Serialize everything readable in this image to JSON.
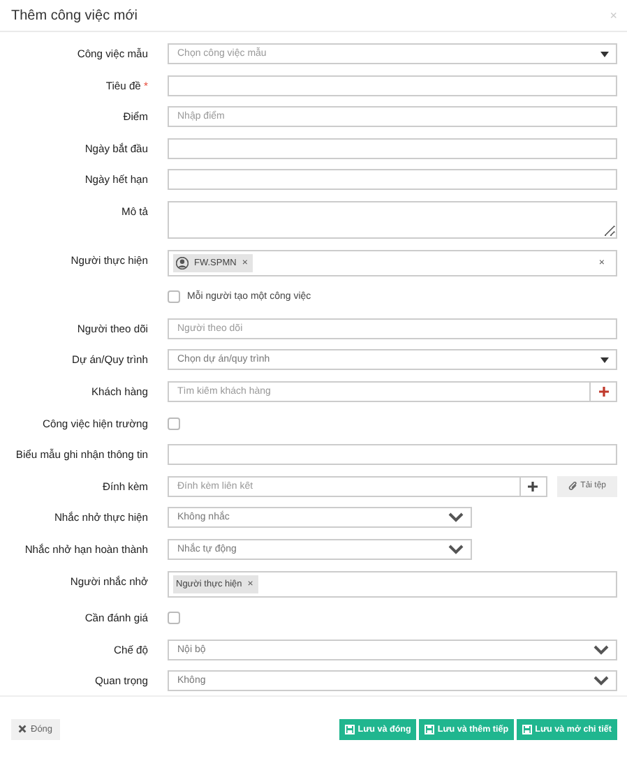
{
  "dialog": {
    "title": "Thêm công việc mới",
    "close": "×"
  },
  "fields": [
    {
      "kind": "caret-select",
      "label": "Công việc mẫu",
      "placeholder": "Chọn công việc mẫu"
    },
    {
      "kind": "text",
      "label": "Tiêu đề",
      "required_mark": "*"
    },
    {
      "kind": "text",
      "label": "Điểm",
      "placeholder": "Nhập điểm"
    },
    {
      "kind": "text",
      "label": "Ngày bắt đầu"
    },
    {
      "kind": "text",
      "label": "Ngày hết hạn"
    },
    {
      "kind": "textarea",
      "label": "Mô tả"
    },
    {
      "kind": "tags",
      "label": "Người thực hiện",
      "tags": [
        {
          "text": "FW.SPMN",
          "avatar": true,
          "remove": "×"
        }
      ],
      "clear": "×"
    },
    {
      "kind": "check-option",
      "text": "Mỗi người tạo một công việc",
      "checked": false
    },
    {
      "kind": "text",
      "label": "Người theo dõi",
      "placeholder": "Người theo dõi"
    },
    {
      "kind": "caret-select",
      "label": "Dự án/Quy trình",
      "value": "Chọn dự án/quy trình"
    },
    {
      "kind": "addon",
      "label": "Khách hàng",
      "placeholder": "Tìm kiếm khách hàng"
    },
    {
      "kind": "checkbox",
      "label": "Công việc hiện trường",
      "checked": false
    },
    {
      "kind": "text",
      "label": "Biểu mẫu ghi nhận thông tin"
    },
    {
      "kind": "attach",
      "label": "Đính kèm",
      "placeholder": "Đính kèm liên kết",
      "button": "Tải tệp"
    },
    {
      "kind": "short-select",
      "label": "Nhắc nhở thực hiện",
      "value": "Không nhắc"
    },
    {
      "kind": "short-select",
      "label": "Nhắc nhở hạn hoàn thành",
      "value": "Nhắc tự động"
    },
    {
      "kind": "tags",
      "label": "Người nhắc nhở",
      "tags": [
        {
          "text": "Người thực hiện",
          "avatar": false,
          "remove": "×"
        }
      ]
    },
    {
      "kind": "checkbox",
      "label": "Cần đánh giá",
      "checked": false
    },
    {
      "kind": "select",
      "label": "Chế độ",
      "value": "Nội bộ"
    },
    {
      "kind": "select",
      "label": "Quan trọng",
      "value": "Không"
    }
  ],
  "footer": {
    "close": "Đóng",
    "actions": [
      "Lưu và đóng",
      "Lưu và thêm tiếp",
      "Lưu và mở chi tiết"
    ]
  }
}
